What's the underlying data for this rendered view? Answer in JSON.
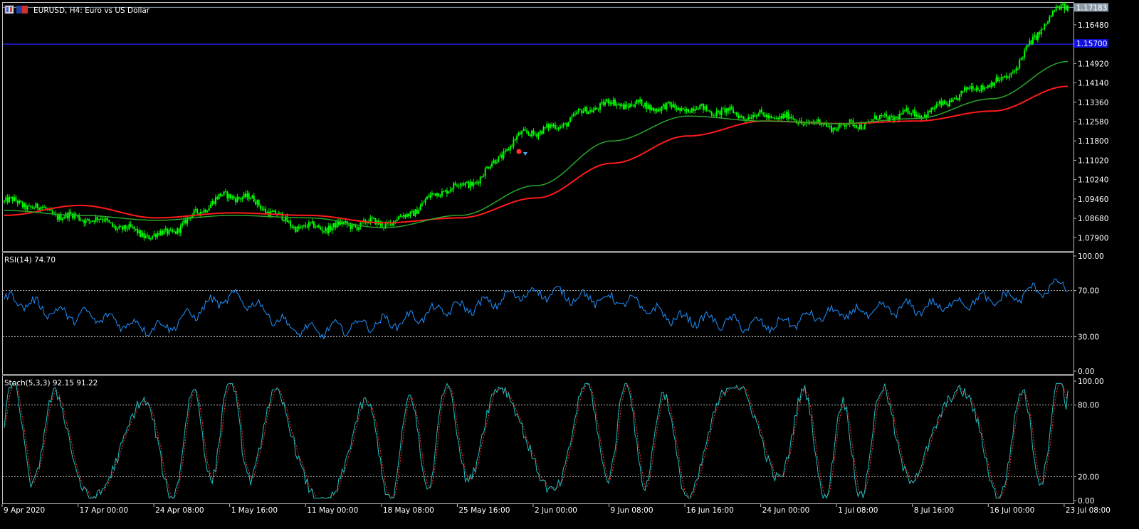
{
  "window": {
    "symbol_title": "EURUSD, H4:  Euro vs US Dollar",
    "icons": [
      "window-icon",
      "flag-icon"
    ]
  },
  "colors": {
    "background": "#000000",
    "grid": "#c0c0c0",
    "candle": "#00ff00",
    "ma_fast": "#2aa62a",
    "ma_slow": "#ff1a1a",
    "hline": "#1e1ed2",
    "price_tag": "#1010e0",
    "rsi": "#1e90ff",
    "stoch_main": "#20c0c0",
    "stoch_signal": "#ff3030"
  },
  "price_panel": {
    "current_price": "1.17183",
    "hline_price": "1.15700",
    "y_ticks": [
      "1.16480",
      "1.14920",
      "1.14140",
      "1.13360",
      "1.12580",
      "1.11800",
      "1.11020",
      "1.10240",
      "1.09460",
      "1.08680",
      "1.07900"
    ]
  },
  "rsi_panel": {
    "title": "RSI(14) 74.70",
    "y_ticks": [
      "100.00",
      "70.00",
      "30.00",
      "0.00"
    ],
    "levels": [
      70,
      30
    ]
  },
  "stoch_panel": {
    "title": "Stoch(5,3,3) 92.15 91.22",
    "y_ticks": [
      "100.00",
      "80.00",
      "20.00",
      "0.00"
    ],
    "levels": [
      80,
      20
    ]
  },
  "time_axis": {
    "labels": [
      "9 Apr 2020",
      "17 Apr 00:00",
      "24 Apr 08:00",
      "1 May 16:00",
      "11 May 00:00",
      "18 May 08:00",
      "25 May 16:00",
      "2 Jun 00:00",
      "9 Jun 08:00",
      "16 Jun 16:00",
      "24 Jun 00:00",
      "1 Jul 08:00",
      "8 Jul 16:00",
      "16 Jul 00:00",
      "23 Jul 08:00"
    ]
  },
  "chart_data": [
    {
      "type": "line",
      "title": "EURUSD, H4:  Euro vs US Dollar",
      "chart_style": "candlestick",
      "ylim": [
        1.0745,
        1.1725
      ],
      "x": [
        "9 Apr 2020",
        "17 Apr 00:00",
        "24 Apr 08:00",
        "1 May 16:00",
        "11 May 00:00",
        "18 May 08:00",
        "25 May 16:00",
        "2 Jun 00:00",
        "9 Jun 08:00",
        "16 Jun 16:00",
        "24 Jun 00:00",
        "1 Jul 08:00",
        "8 Jul 16:00",
        "16 Jul 00:00",
        "23 Jul 08:00"
      ],
      "series": [
        {
          "values": [
            1.0935,
            1.087,
            1.08,
            1.096,
            1.083,
            1.085,
            1.1,
            1.122,
            1.133,
            1.131,
            1.128,
            1.124,
            1.129,
            1.141,
            1.1718
          ]
        },
        {
          "values": [
            1.09,
            1.088,
            1.086,
            1.088,
            1.087,
            1.083,
            1.088,
            1.1,
            1.118,
            1.128,
            1.126,
            1.125,
            1.127,
            1.135,
            1.15
          ]
        },
        {
          "values": [
            1.088,
            1.092,
            1.087,
            1.089,
            1.088,
            1.085,
            1.087,
            1.095,
            1.109,
            1.12,
            1.126,
            1.125,
            1.126,
            1.13,
            1.14
          ]
        }
      ]
    },
    {
      "type": "line",
      "title": "RSI(14) 74.70",
      "ylim": [
        0,
        100
      ],
      "x": [
        "9 Apr 2020",
        "17 Apr 00:00",
        "24 Apr 08:00",
        "1 May 16:00",
        "11 May 00:00",
        "18 May 08:00",
        "25 May 16:00",
        "2 Jun 00:00",
        "9 Jun 08:00",
        "16 Jun 16:00",
        "24 Jun 00:00",
        "1 Jul 08:00",
        "8 Jul 16:00",
        "16 Jul 00:00",
        "23 Jul 08:00"
      ],
      "series": [
        {
          "values": [
            62,
            48,
            38,
            63,
            35,
            42,
            55,
            68,
            62,
            45,
            40,
            50,
            55,
            62,
            74.7
          ]
        }
      ]
    },
    {
      "type": "line",
      "title": "Stoch(5,3,3) 92.15 91.22",
      "ylim": [
        0,
        100
      ],
      "x": [
        "9 Apr 2020",
        "17 Apr 00:00",
        "24 Apr 08:00",
        "1 May 16:00",
        "11 May 00:00",
        "18 May 08:00",
        "25 May 16:00",
        "2 Jun 00:00",
        "9 Jun 08:00",
        "16 Jun 16:00",
        "24 Jun 00:00",
        "1 Jul 08:00",
        "8 Jul 16:00",
        "16 Jul 00:00",
        "23 Jul 08:00"
      ],
      "series": [
        {
          "values": [
            85,
            30,
            20,
            92,
            15,
            20,
            80,
            45,
            85,
            30,
            90,
            20,
            85,
            30,
            92.15
          ]
        },
        {
          "values": [
            82,
            35,
            25,
            88,
            20,
            25,
            75,
            50,
            80,
            35,
            85,
            25,
            80,
            35,
            91.22
          ]
        }
      ]
    }
  ]
}
